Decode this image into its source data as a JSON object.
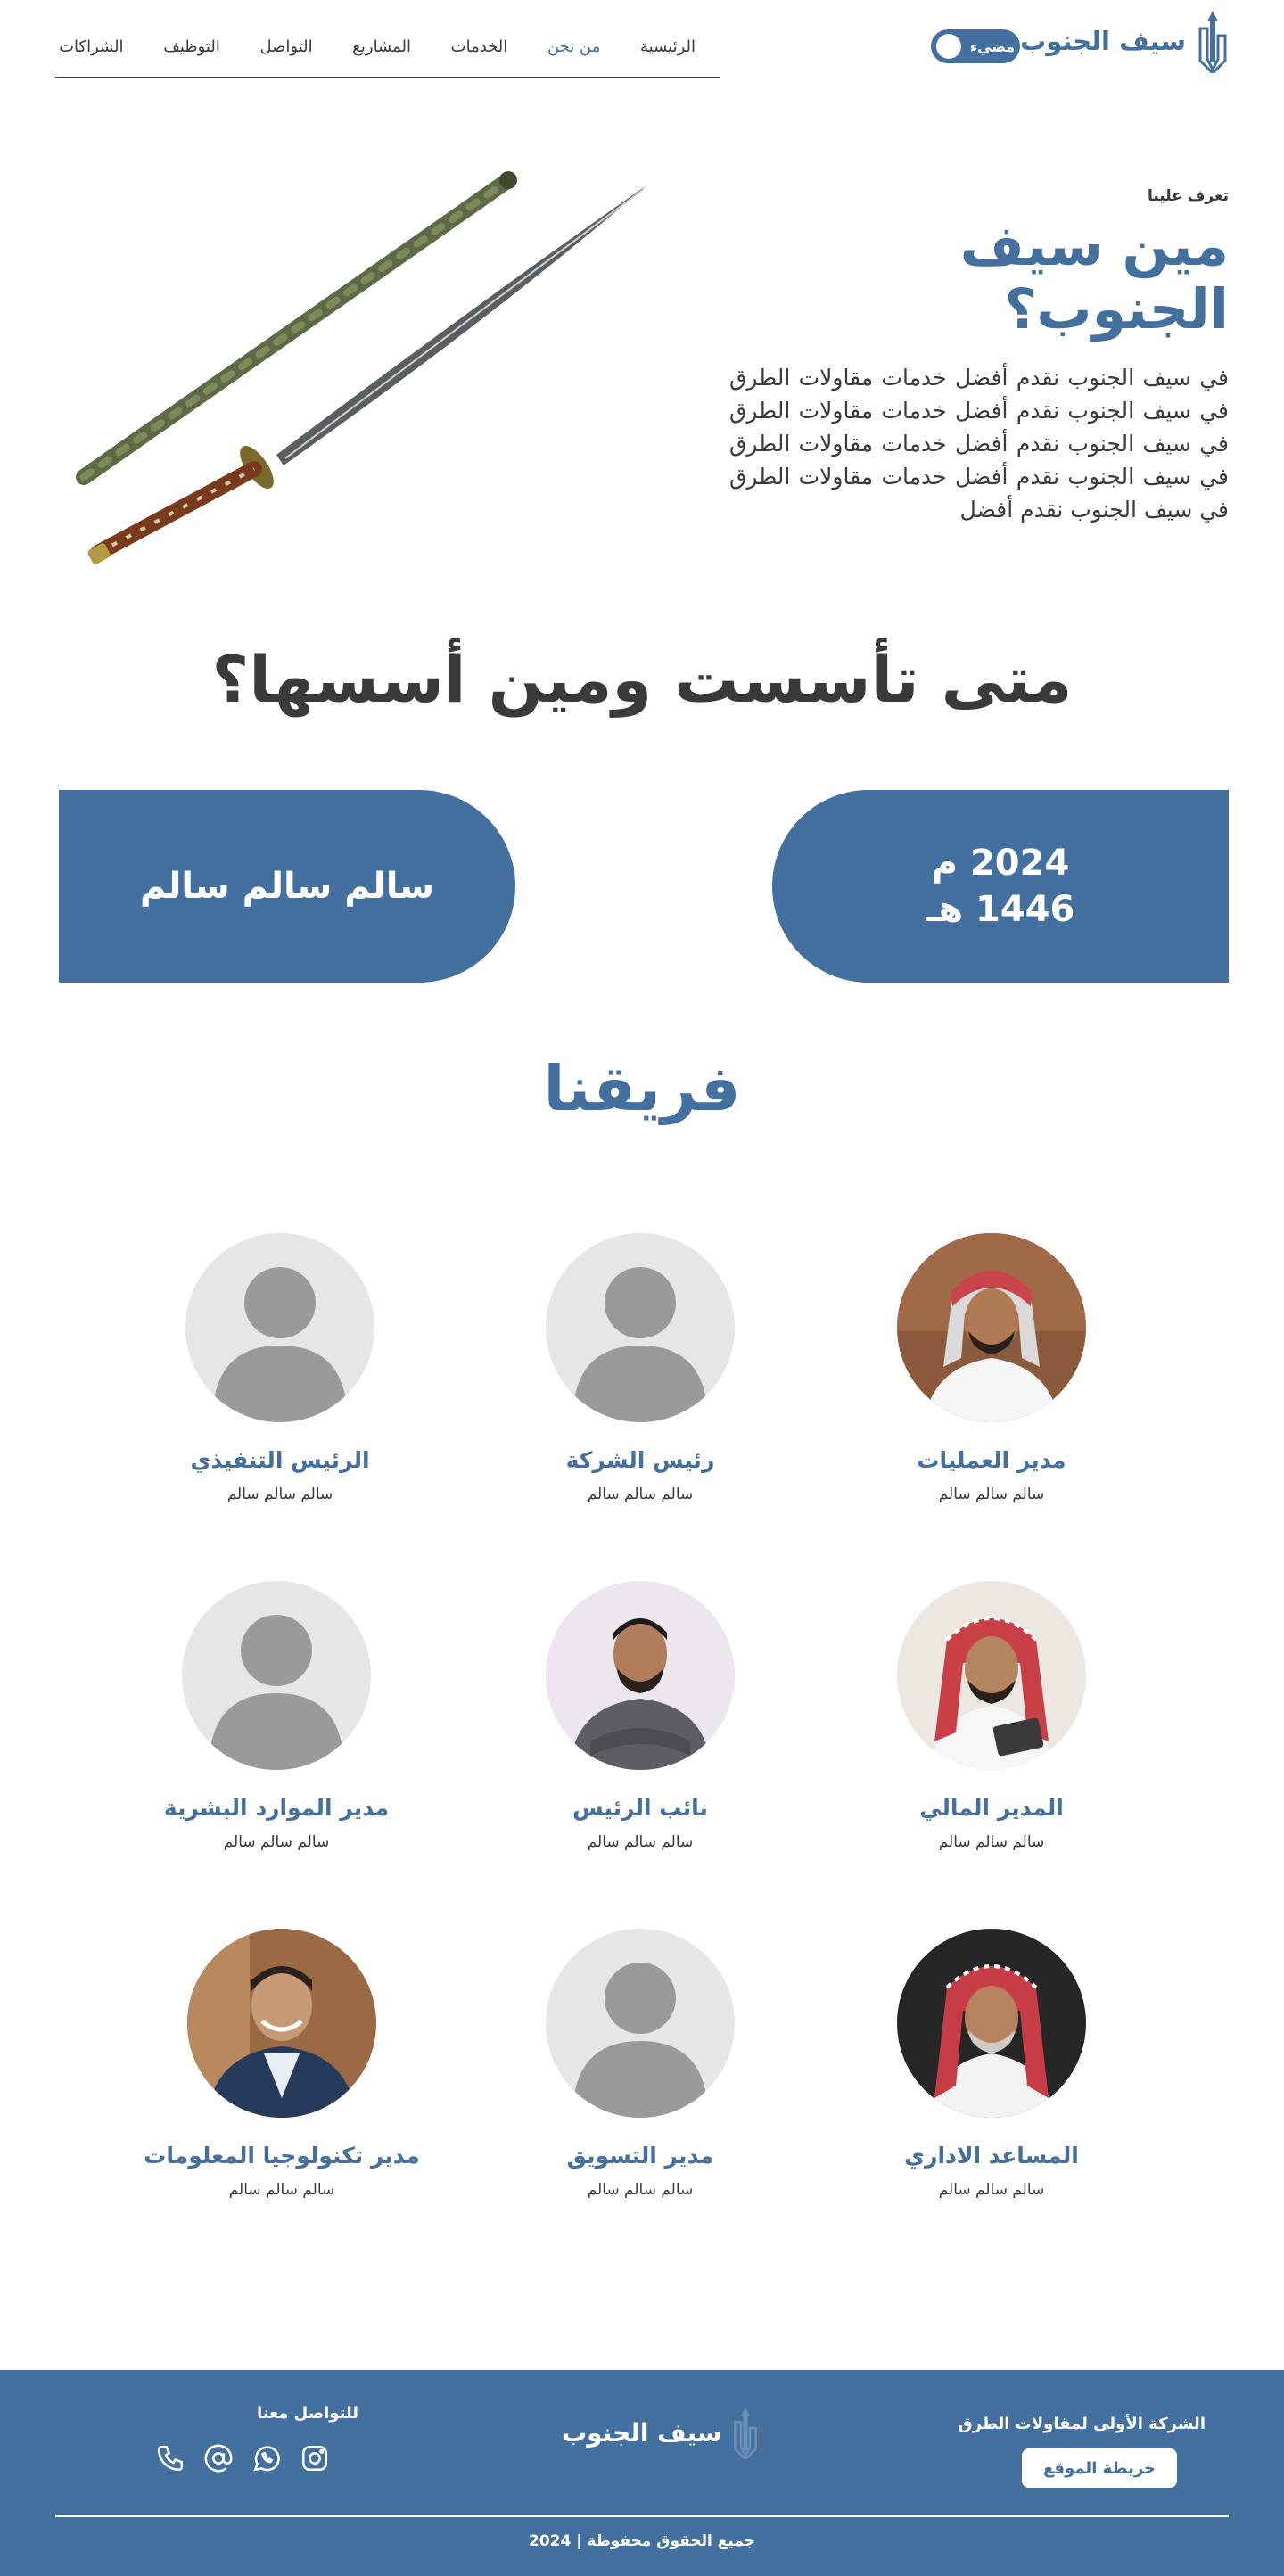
{
  "header": {
    "logo_text": "سيف الجنوب",
    "theme_toggle_label": "مضيء",
    "nav": [
      {
        "label": "الرئيسية",
        "active": false
      },
      {
        "label": "من نحن",
        "active": true
      },
      {
        "label": "الخدمات",
        "active": false
      },
      {
        "label": "المشاريع",
        "active": false
      },
      {
        "label": "التواصل",
        "active": false
      },
      {
        "label": "التوظيف",
        "active": false
      },
      {
        "label": "الشراكات",
        "active": false
      }
    ]
  },
  "about": {
    "eyebrow": "تعرف علينا",
    "title": "مين سيف الجنوب؟",
    "body": "في سيف الجنوب نقدم أفضل خدمات مقاولات الطرق في سيف الجنوب نقدم أفضل خدمات مقاولات الطرق في سيف الجنوب نقدم أفضل خدمات مقاولات الطرق في سيف الجنوب نقدم أفضل خدمات مقاولات الطرق في سيف الجنوب نقدم أفضل"
  },
  "founded": {
    "title": "متى تأسست ومين أسسها؟",
    "date_gregorian": "2024 م",
    "date_hijri": "1446 هـ",
    "founder": "سالم سالم سالم"
  },
  "team": {
    "title": "فريقنا",
    "members": [
      {
        "role": "مدير العمليات",
        "name": "سالم سالم سالم",
        "avatar": "photo-man-white-shemagh"
      },
      {
        "role": "رئيس الشركة",
        "name": "سالم سالم سالم",
        "avatar": "placeholder"
      },
      {
        "role": "الرئيس التنفيذي",
        "name": "سالم سالم سالم",
        "avatar": "placeholder"
      },
      {
        "role": "المدير المالي",
        "name": "سالم سالم سالم",
        "avatar": "photo-man-red-shemagh-tablet"
      },
      {
        "role": "نائب الرئيس",
        "name": "سالم سالم سالم",
        "avatar": "photo-man-grey-sweater"
      },
      {
        "role": "مدير الموارد البشرية",
        "name": "سالم سالم سالم",
        "avatar": "placeholder"
      },
      {
        "role": "المساعد الاداري",
        "name": "سالم سالم سالم",
        "avatar": "photo-man-red-shemagh-beard"
      },
      {
        "role": "مدير التسويق",
        "name": "سالم سالم سالم",
        "avatar": "placeholder"
      },
      {
        "role": "مدير تكنولوجيا المعلومات",
        "name": "سالم سالم سالم",
        "avatar": "photo-man-suit"
      }
    ]
  },
  "footer": {
    "company": "الشركة الأولى لمقاولات الطرق",
    "sitemap_label": "خريطة الموقع",
    "logo_text": "سيف الجنوب",
    "contact_label": "للتواصل معنا",
    "social": [
      "phone-icon",
      "email-at-icon",
      "whatsapp-icon",
      "instagram-icon"
    ],
    "copyright": "جميع الحقوق محفوظة | 2024"
  },
  "colors": {
    "brand": "#4470a0",
    "text": "#3a3a3a",
    "placeholder_bg": "#e6e6e6",
    "placeholder_fg": "#9a9a9a"
  }
}
